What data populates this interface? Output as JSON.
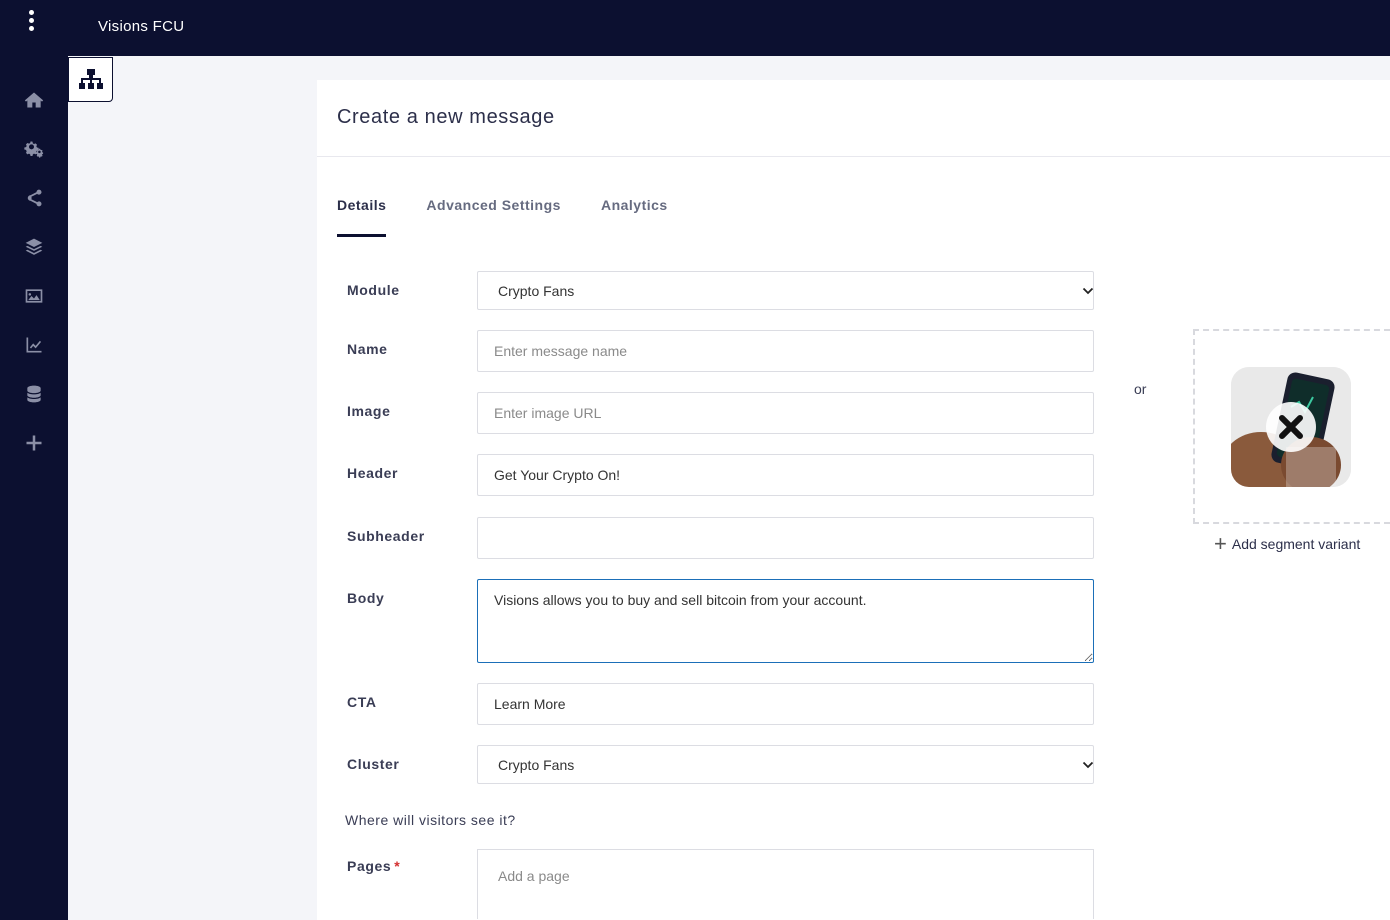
{
  "topbar": {
    "brand": "Visions FCU"
  },
  "sidebar": {
    "items": [
      {
        "icon": "home-icon"
      },
      {
        "icon": "settings-icon"
      },
      {
        "icon": "share-icon"
      },
      {
        "icon": "layers-icon"
      },
      {
        "icon": "image-icon"
      },
      {
        "icon": "analytics-icon"
      },
      {
        "icon": "database-icon"
      },
      {
        "icon": "plus-icon"
      }
    ]
  },
  "card": {
    "title": "Create a new message",
    "tabs": [
      {
        "label": "Details",
        "active": true
      },
      {
        "label": "Advanced Settings",
        "active": false
      },
      {
        "label": "Analytics",
        "active": false
      }
    ]
  },
  "form": {
    "module": {
      "label": "Module",
      "value": "Crypto Fans"
    },
    "name": {
      "label": "Name",
      "placeholder": "Enter message name",
      "value": ""
    },
    "image": {
      "label": "Image",
      "placeholder": "Enter image URL",
      "value": ""
    },
    "header": {
      "label": "Header",
      "value": "Get Your Crypto On!"
    },
    "subheader": {
      "label": "Subheader",
      "value": ""
    },
    "body": {
      "label": "Body",
      "value": "Visions allows you to buy and sell bitcoin from your account."
    },
    "cta": {
      "label": "CTA",
      "value": "Learn More"
    },
    "cluster": {
      "label": "Cluster",
      "value": "Crypto Fans"
    },
    "visibility_question": "Where will visitors see it?",
    "pages": {
      "label": "Pages",
      "required_mark": "*",
      "placeholder": "Add a page"
    }
  },
  "variant": {
    "or_text": "or",
    "add_label": "Add segment variant",
    "add_icon": "+"
  }
}
